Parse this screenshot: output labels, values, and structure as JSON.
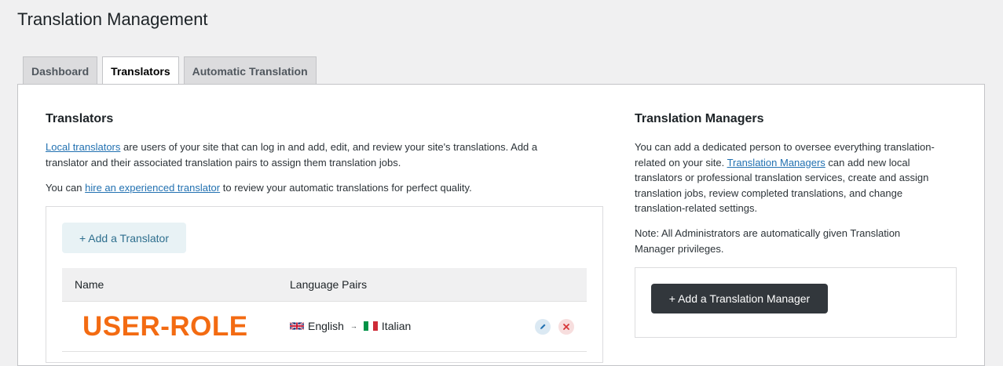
{
  "page": {
    "title": "Translation Management"
  },
  "tabs": [
    {
      "label": "Dashboard",
      "active": false
    },
    {
      "label": "Translators",
      "active": true
    },
    {
      "label": "Automatic Translation",
      "active": false
    }
  ],
  "translators": {
    "title": "Translators",
    "intro_link": "Local translators",
    "intro_line1_rest": " are users of your site that can log in and add, edit, and review your site's translations. Add a",
    "intro_line2": "translator and their associated translation pairs to assign them translation jobs.",
    "hire_prefix": "You can ",
    "hire_link": "hire an experienced translator",
    "hire_suffix": " to review your automatic translations for perfect quality.",
    "add_button": "+ Add a Translator",
    "columns": {
      "name": "Name",
      "pairs": "Language Pairs"
    },
    "rows": [
      {
        "name": "USER-ROLE",
        "from": "English",
        "to": "Italian",
        "edit_icon": "pencil-icon",
        "delete_icon": "close-icon"
      }
    ]
  },
  "managers": {
    "title": "Translation Managers",
    "line1": "You can add a dedicated person to oversee everything translation-",
    "line2_prefix": "related on your site. ",
    "line2_link": "Translation Managers",
    "line2_suffix": " can add new local",
    "line3": "translators or professional translation services, create and assign",
    "line4": "translation jobs, review completed translations, and change",
    "line5": "translation-related settings.",
    "note_line1": "Note: All Administrators are automatically given Translation",
    "note_line2": "Manager privileges.",
    "add_button": "+ Add a Translation Manager"
  },
  "colors": {
    "accent_link": "#2271b1",
    "role_label": "#f36b12",
    "dark_button": "#32373c"
  }
}
